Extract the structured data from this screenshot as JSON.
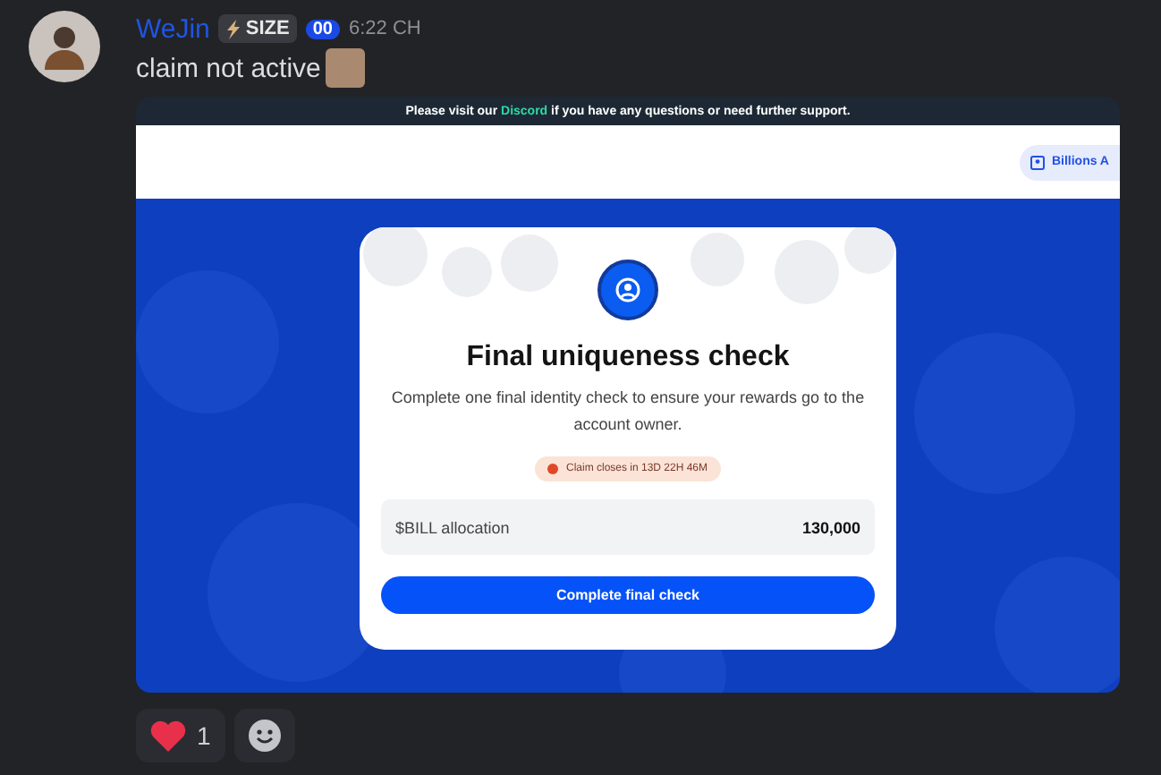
{
  "message": {
    "author": "WeJin",
    "tag": "SIZE",
    "badge": "00",
    "time": "6:22 CH",
    "text": "claim not active"
  },
  "embed": {
    "notice_link": "Discord",
    "notice_before": "Please visit our ",
    "notice_after": " if you have any questions or need further support.",
    "header_pill": "Billions A",
    "card": {
      "title": "Final uniqueness check",
      "description": "Complete one final identity check to ensure your rewards go to the account owner.",
      "deadline": "Claim closes in 13D 22H 46M",
      "allocation_label": "$BILL allocation",
      "allocation_value": "130,000",
      "button": "Complete final check"
    }
  },
  "reactions": [
    {
      "kind": "heart",
      "count": "1"
    },
    {
      "kind": "add"
    }
  ]
}
